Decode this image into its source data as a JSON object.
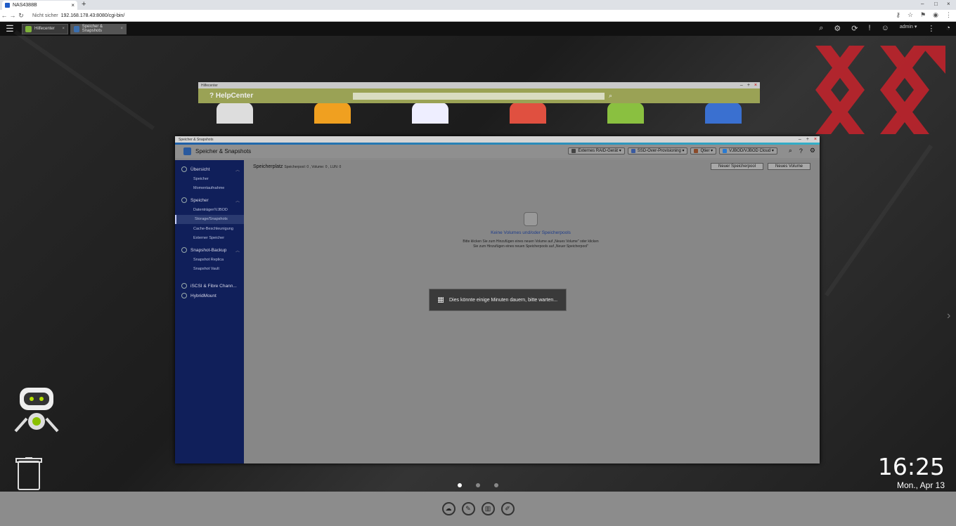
{
  "browser": {
    "tab_title": "NAS4388B",
    "tab_close": "×",
    "new_tab": "+",
    "security_label": "Nicht sicher",
    "url": "192.168.178.43:8080/cgi-bin/",
    "minimize": "–",
    "maximize": "□",
    "close": "×"
  },
  "qts_bar": {
    "menu_icon": "☰",
    "tabs": [
      {
        "label": "Hilfecenter",
        "color": "#7fb33a",
        "close": "×"
      },
      {
        "label": "Speicher & Snapshots",
        "color": "#3a6fb0",
        "close": "×"
      }
    ],
    "user_label": "admin ▾"
  },
  "help_window": {
    "title": "Hilfecenter",
    "brand": "? HelpCenter",
    "controls": [
      "–",
      "+",
      "×"
    ]
  },
  "main_window": {
    "title": "Speicher & Snapshots",
    "app_title": "Speicher & Snapshots",
    "controls": [
      "–",
      "+",
      "×"
    ],
    "toolbar": [
      {
        "label": "Externes RAID-Gerät ▾",
        "icon": "raid-icon",
        "color": "#444"
      },
      {
        "label": "SSD-Over-Provisioning ▾",
        "icon": "ssd-icon",
        "color": "#3a5aa0"
      },
      {
        "label": "Qtier ▾",
        "icon": "qtier-icon",
        "color": "#8a4a2a"
      },
      {
        "label": "VJBOD/VJBOD Cloud ▾",
        "icon": "cloud-icon",
        "color": "#2a7ad0"
      }
    ],
    "sidebar": {
      "groups": [
        {
          "label": "Übersicht",
          "items": [
            "Speicher",
            "Momentaufnahme"
          ]
        },
        {
          "label": "Speicher",
          "items": [
            "Datenträger/VJBOD",
            "Storage/Snapshots",
            "Cache-Beschleunigung",
            "Externer Speicher"
          ]
        },
        {
          "label": "Snapshot-Backup",
          "items": [
            "Snapshot Replica",
            "Snapshot Vault"
          ]
        },
        {
          "label": "iSCSI & Fibre Chann...",
          "items": []
        },
        {
          "label": "HybridMount",
          "items": []
        }
      ],
      "active_item": "Storage/Snapshots"
    },
    "content": {
      "heading": "Speicherplatz",
      "summary": "Speicherpool: 0 , Volume: 0 , LUN: 0",
      "btn_new_pool": "Neuer Speicherpool",
      "btn_new_volume": "Neues Volume",
      "empty_title": "Keine Volumes und/oder Speicherpools",
      "empty_desc": "Bitte klicken Sie zum Hinzufügen eines neuen Volume auf „Neues Volume\" oder klicken Sie zum Hinzufügen eines neuen Speicherpools auf „Neuer Speicherpool\""
    }
  },
  "wait_dialog": {
    "message": "Dies könnte einige Minuten dauern, bitte warten..."
  },
  "clock": {
    "time": "16:25",
    "date": "Mon., Apr 13"
  },
  "page_dots": 3,
  "active_page": 1
}
